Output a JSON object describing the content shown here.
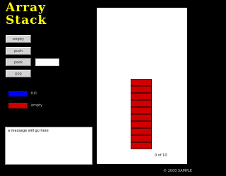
{
  "title": {
    "line1": "Array",
    "line2": "Stack"
  },
  "buttons": [
    {
      "label": "empty"
    },
    {
      "label": "push"
    },
    {
      "label": "peek"
    },
    {
      "label": "pop"
    }
  ],
  "peek_field": {
    "value": "",
    "placeholder": ""
  },
  "legend": {
    "full_label": "full",
    "empty_label": "empty",
    "full_color": "#0000ff",
    "empty_color": "#d00000"
  },
  "message": {
    "text": "a message will go here"
  },
  "panel": {
    "caption": "0 of 10"
  },
  "stack": {
    "capacity": 10,
    "filled": 0,
    "cell_empty_color": "#d00000",
    "cell_full_color": "#0000ff"
  },
  "copyright": "© 2000 SAMPLE"
}
